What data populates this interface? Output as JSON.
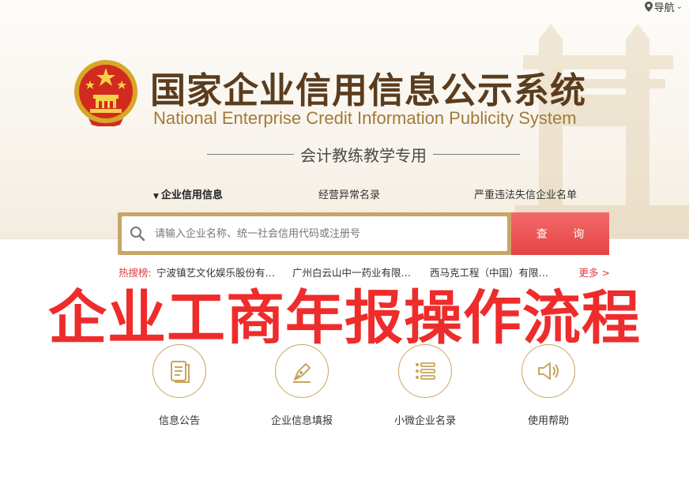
{
  "nav": {
    "label": "导航",
    "icon": "location-pin-icon"
  },
  "header": {
    "title_cn": "国家企业信用信息公示系统",
    "title_en": "National Enterprise Credit Information Publicity System",
    "subtitle": "会计教练教学专用"
  },
  "tabs": [
    {
      "label": "企业信用信息",
      "active": true
    },
    {
      "label": "经营异常名录",
      "active": false
    },
    {
      "label": "严重违法失信企业名单",
      "active": false
    }
  ],
  "search": {
    "placeholder": "请输入企业名称、统一社会信用代码或注册号",
    "button_label": "查 询"
  },
  "hot_search": {
    "label": "热搜榜:",
    "items": [
      "宁波镇艺文化娱乐股份有…",
      "广州白云山中一药业有限…",
      "西马克工程（中国）有限…"
    ],
    "more": "更多 >"
  },
  "banner": "企业工商年报操作流程",
  "services": [
    {
      "label": "信息公告",
      "icon": "announcement-icon"
    },
    {
      "label": "企业信息填报",
      "icon": "pen-fill-icon"
    },
    {
      "label": "小微企业名录",
      "icon": "list-icon"
    },
    {
      "label": "使用帮助",
      "icon": "speaker-icon"
    }
  ],
  "colors": {
    "gold": "#c9a55a",
    "brown": "#5a3d1e",
    "red": "#ee2c2c",
    "search_btn": "#e54444"
  }
}
